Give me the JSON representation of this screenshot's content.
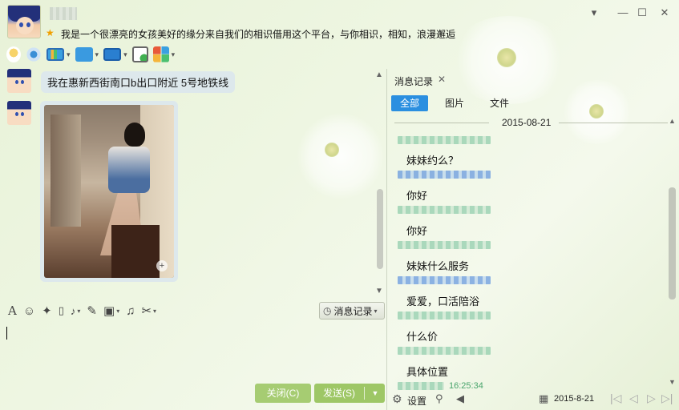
{
  "header": {
    "signature": "我是一个很漂亮的女孩美好的缘分来自我们的相识借用这个平台，与你相识，相知，浪漫邂逅",
    "star_glyph": "★",
    "controls": {
      "settings": "▾",
      "minimize": "—",
      "maximize": "☐",
      "close": "✕"
    }
  },
  "toolbar": {
    "icons": [
      "voice-call-icon",
      "video-call-icon",
      "screen-share-icon",
      "file-transfer-icon",
      "remote-desktop-icon",
      "new-group-icon",
      "apps-icon"
    ],
    "caret": "▾"
  },
  "chat": {
    "messages": [
      {
        "type": "text",
        "text": "我在惠新西街南口b出口附近 5号地铁线"
      },
      {
        "type": "image",
        "zoom_glyph": "+"
      }
    ],
    "scroll_up": "▲",
    "scroll_down": "▼"
  },
  "input_toolbar": {
    "font_glyph": "A",
    "emoji_glyph": "☺",
    "magic_glyph": "✦",
    "screenshot_glyph": "✂",
    "voice_glyph": "🎤",
    "edit_glyph": "✎",
    "image_glyph": "▣",
    "music_glyph": "♫",
    "scissors_glyph": "✂",
    "caret": "▾",
    "history_label": "消息记录",
    "history_clock": "◷"
  },
  "buttons": {
    "close": "关闭(C)",
    "send": "发送(S)",
    "send_caret": "▼"
  },
  "history_panel": {
    "title": "消息记录",
    "close_glyph": "✕",
    "tabs": [
      {
        "label": "全部",
        "active": true
      },
      {
        "label": "图片",
        "active": false
      },
      {
        "label": "文件",
        "active": false
      }
    ],
    "date": "2015-08-21",
    "records": [
      {
        "text": "妹妹约么？"
      },
      {
        "text": "你好"
      },
      {
        "text": "你好"
      },
      {
        "text": "妹妹什么服务"
      },
      {
        "text": "爱爱，口活陪浴"
      },
      {
        "text": "什么价"
      },
      {
        "text": "具体位置"
      }
    ],
    "last_meta_time": "16:25:34",
    "footer": {
      "settings_label": "设置",
      "date": "2015-8-21",
      "nav": [
        "|◁",
        "◁",
        "▷",
        "▷|"
      ]
    }
  },
  "colors": {
    "accent_blue": "#2b8fe0",
    "button_green": "#9ec766",
    "background": "#eef6e2"
  }
}
